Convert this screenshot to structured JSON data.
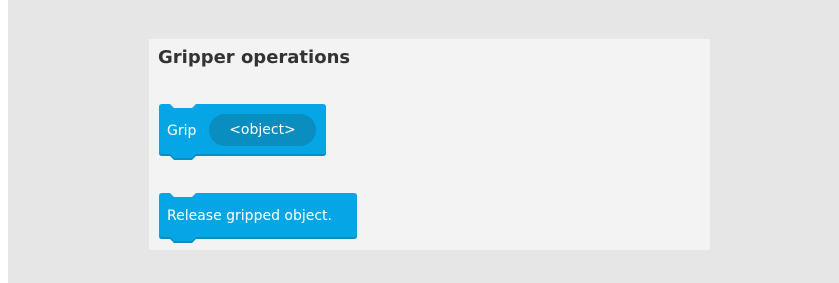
{
  "panel": {
    "title": "Gripper operations"
  },
  "blocks": {
    "grip": {
      "label": "Grip",
      "parameter_placeholder": "<object>"
    },
    "release": {
      "label": "Release gripped object."
    }
  },
  "colors": {
    "block_fill": "#06a6e6",
    "block_shadow": "#0a8dbf",
    "parameter_fill": "#0a8dbf",
    "panel_background": "#f3f3f3",
    "outer_background": "#e6e6e6",
    "title_text": "#333333"
  }
}
